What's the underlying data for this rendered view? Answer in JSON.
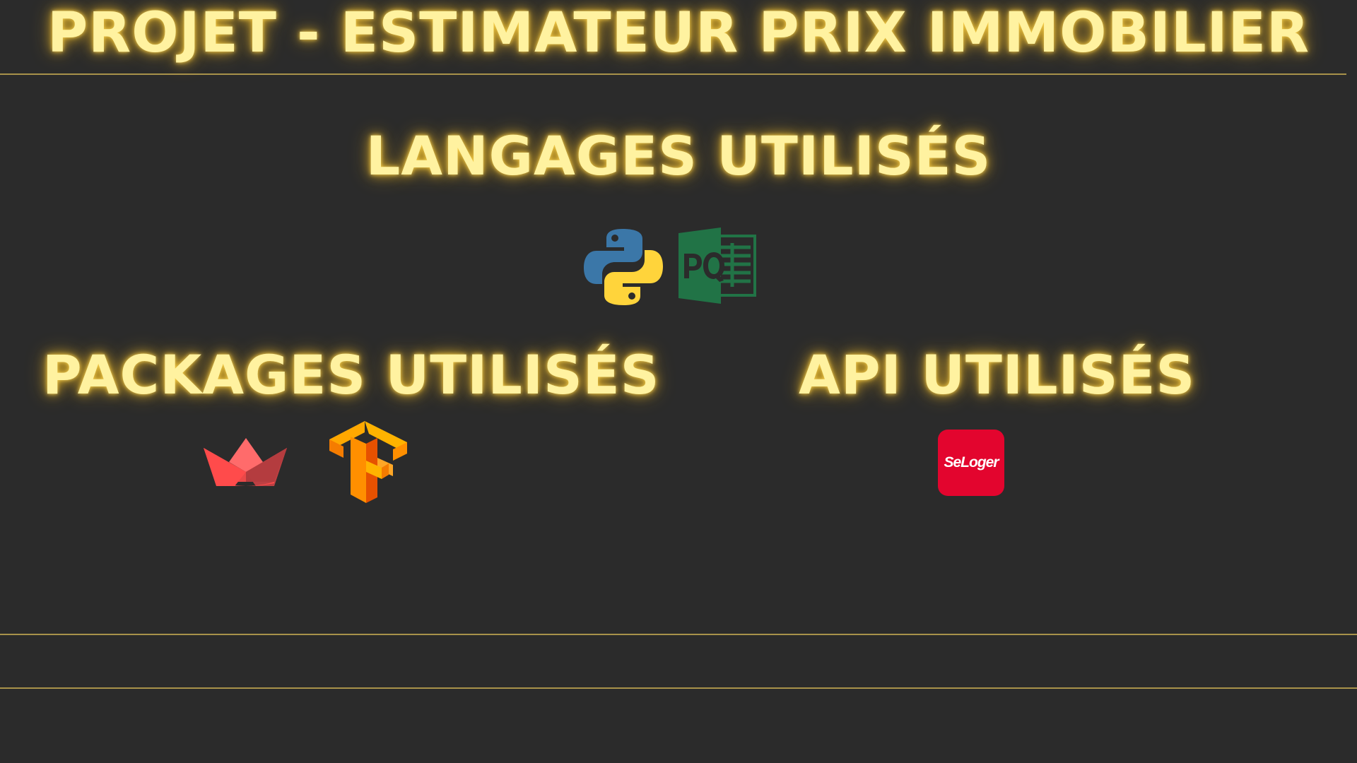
{
  "title": "PROJET - ESTIMATEUR PRIX IMMOBILIER",
  "sections": {
    "languages": {
      "heading": "LANGAGES UTILISÉS",
      "icons": [
        "python-icon",
        "power-query-icon"
      ]
    },
    "packages": {
      "heading": "PACKAGES UTILISÉS",
      "icons": [
        "streamlit-icon",
        "tensorflow-icon"
      ]
    },
    "api": {
      "heading": "API UTILISÉS",
      "icons": [
        "seloger-icon"
      ],
      "seloger_label": "SeLoger"
    }
  },
  "colors": {
    "background": "#2b2b2b",
    "heading_text": "#fff2a0",
    "heading_glow": "#ffc828",
    "rule": "#a8924a",
    "python_blue": "#3b77a8",
    "python_yellow": "#ffd43b",
    "power_query_green": "#217346",
    "streamlit_red": "#ff4b4b",
    "tensorflow_orange": "#ff8f00",
    "seloger_red": "#e3052e"
  }
}
